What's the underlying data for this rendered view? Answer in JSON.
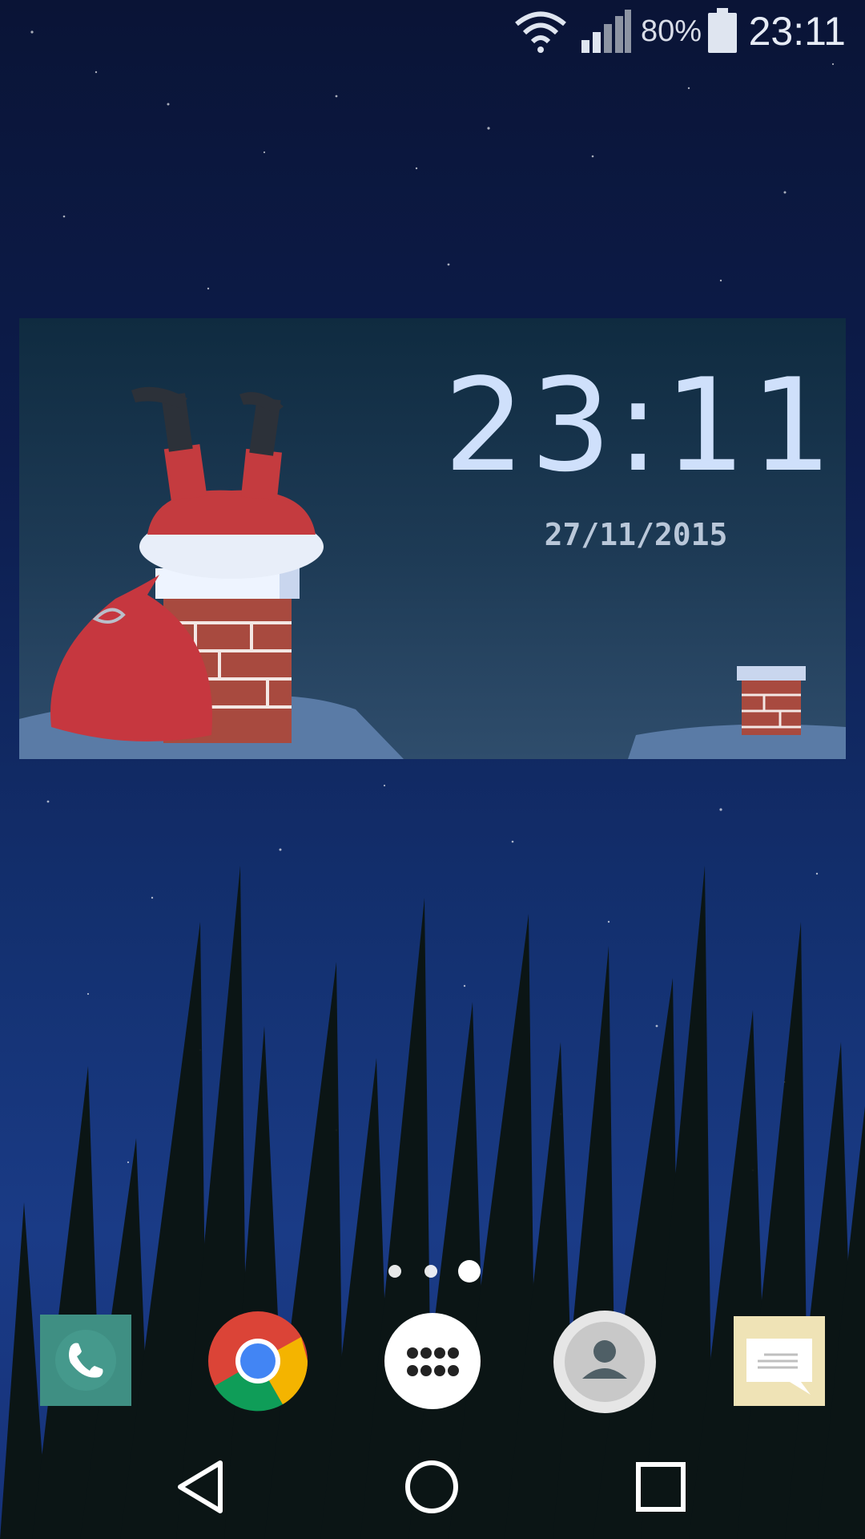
{
  "status_bar": {
    "battery_percent": "80%",
    "time": "23:11",
    "icons": [
      "wifi-icon",
      "signal-icon",
      "battery-icon"
    ]
  },
  "clock_widget": {
    "time": "23:11",
    "date": "27/11/2015"
  },
  "home": {
    "page_indicator": {
      "page_count": 3,
      "current_page": 3
    }
  },
  "dock": {
    "apps": [
      {
        "icon": "phone-icon"
      },
      {
        "icon": "chrome-icon"
      },
      {
        "icon": "app-drawer-icon"
      },
      {
        "icon": "contacts-icon"
      },
      {
        "icon": "messaging-icon"
      }
    ]
  },
  "navigation_bar": {
    "buttons": [
      "back-icon",
      "home-icon",
      "recents-icon"
    ]
  },
  "colors": {
    "widget_time": "#cfe0fb",
    "widget_date": "#b9c7d9",
    "sky_top": "#0a1436",
    "sky_bottom": "#1a3b86"
  }
}
